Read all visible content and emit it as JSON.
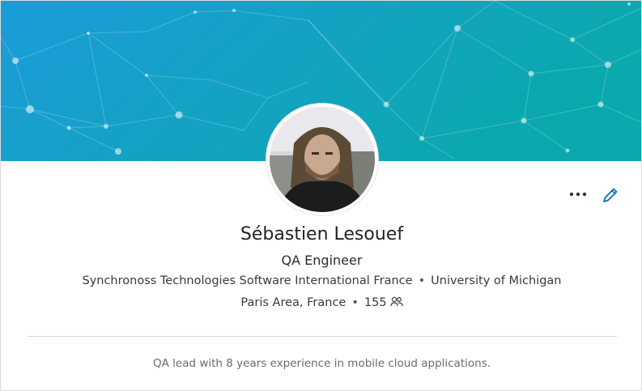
{
  "profile": {
    "name": "Sébastien Lesouef",
    "headline": "QA Engineer",
    "company": "Synchronoss Technologies Software International France",
    "school": "University of Michigan",
    "location": "Paris Area, France",
    "connections": "155",
    "separator": "•",
    "summary": "QA lead with 8 years experience in mobile cloud applications."
  },
  "icons": {
    "more": "ellipsis-icon",
    "edit": "pencil-icon",
    "connections": "people-icon"
  },
  "colors": {
    "banner_start": "#1a9fd6",
    "banner_end": "#0aa6b3",
    "accent": "#0073b1"
  }
}
